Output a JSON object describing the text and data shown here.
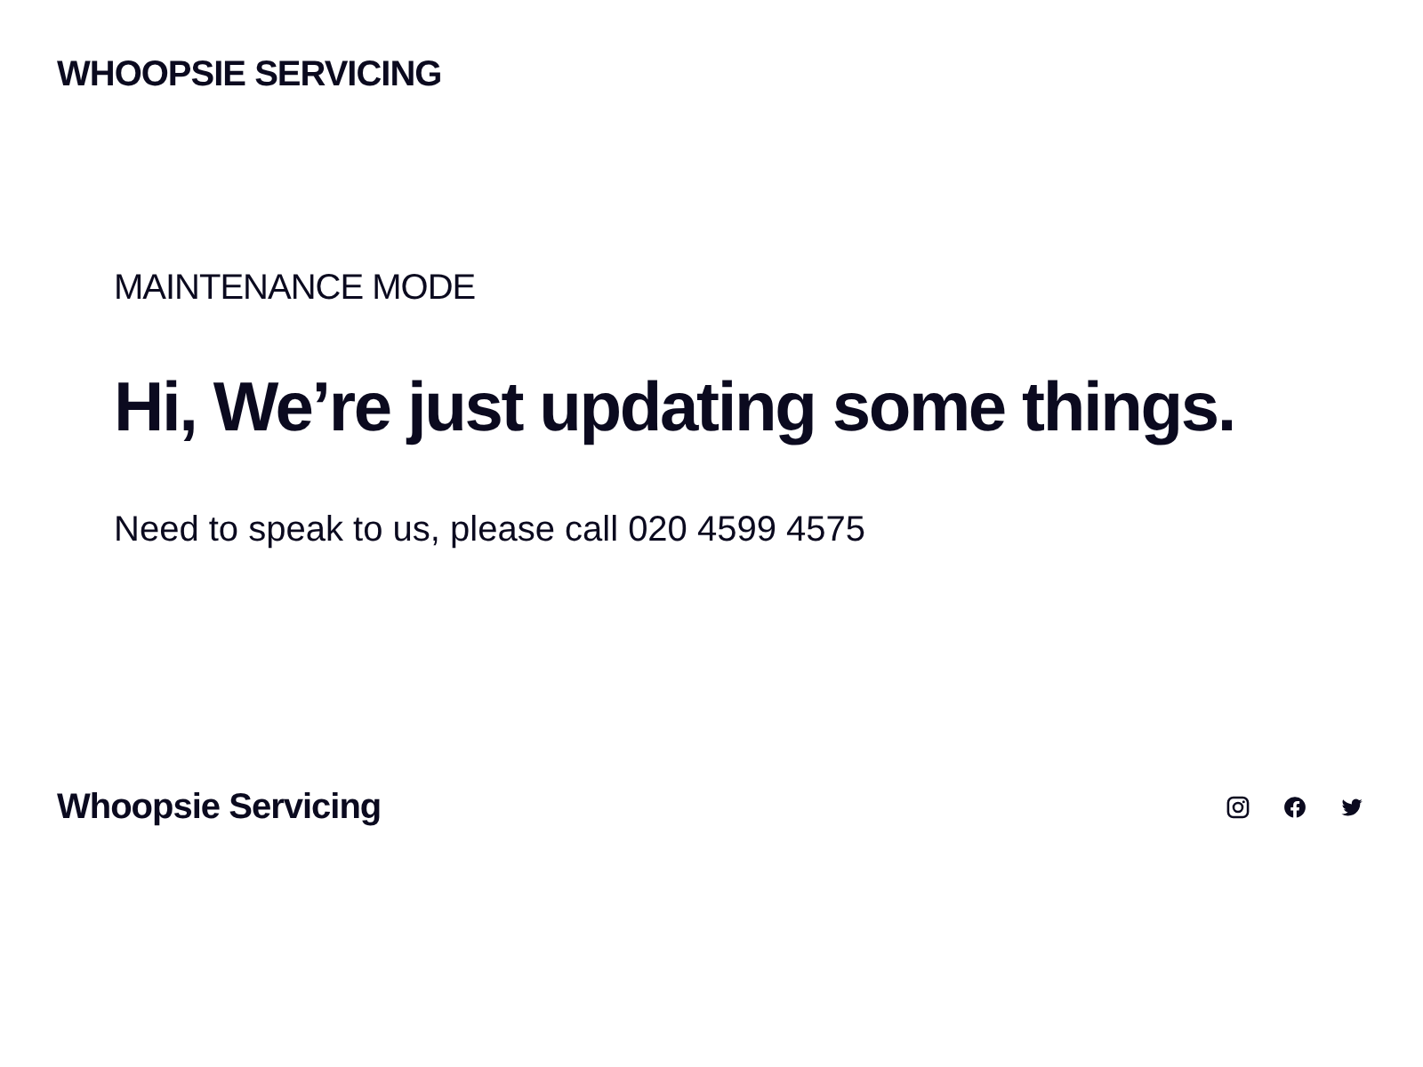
{
  "header": {
    "site_title": "WHOOPSIE SERVICING"
  },
  "main": {
    "eyebrow": "MAINTENANCE MODE",
    "heading": "Hi, We’re just updating some things.",
    "message": "Need to speak to us, please call 020 4599 4575"
  },
  "footer": {
    "site_title": "Whoopsie Servicing",
    "social_links": [
      {
        "kind": "instagram"
      },
      {
        "kind": "facebook"
      },
      {
        "kind": "twitter"
      }
    ]
  }
}
